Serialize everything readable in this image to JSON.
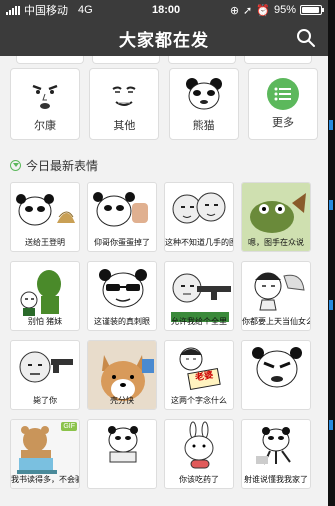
{
  "status_bar": {
    "carrier": "中国移动",
    "network": "4G",
    "time": "18:00",
    "battery": "95%",
    "battery_level": 0.95
  },
  "header": {
    "title": "大家都在发",
    "search_icon": "search-icon"
  },
  "categories": [
    {
      "label": "尔康",
      "icon": "erkang-face"
    },
    {
      "label": "其他",
      "icon": "smug-face"
    },
    {
      "label": "熊猫",
      "icon": "panda-face"
    },
    {
      "label": "更多",
      "icon": "list-icon"
    }
  ],
  "section": {
    "title": "今日最新表情"
  },
  "stickers": [
    {
      "caption": "送给王登明",
      "type": "panda-poop"
    },
    {
      "caption": "仰哥你蛋蛋掉了",
      "type": "panda-hand"
    },
    {
      "caption": "这种不知道几手的图你还在发",
      "type": "two-faces"
    },
    {
      "caption": "嗯，图手在众说",
      "type": "frog-cartoon"
    },
    {
      "caption": "别怕  猪妹",
      "type": "green-monster"
    },
    {
      "caption": "这谨装的真刺眼",
      "type": "panda-sunglasses"
    },
    {
      "caption": "允许我给个全里",
      "type": "face-gun"
    },
    {
      "caption": "你都要上天当仙女么",
      "type": "girl-fan"
    },
    {
      "caption": "毙了你",
      "type": "face-pistol"
    },
    {
      "caption": "壳分快",
      "type": "shiba-dog"
    },
    {
      "caption": "这两个字念什么",
      "type": "girl-sign",
      "sign": "老婆"
    },
    {
      "caption": "",
      "type": "panda-angry"
    },
    {
      "caption": "我书读得多，不会骗人的",
      "type": "bear-reading",
      "badge": "GIF"
    },
    {
      "caption": "",
      "type": "panda-book"
    },
    {
      "caption": "你该吃药了",
      "type": "bunny-pill"
    },
    {
      "caption": "射谁说懂我我家了",
      "type": "panda-running"
    }
  ],
  "colors": {
    "bar": "#3b3b3b",
    "accent": "#5cb85c",
    "background": "#f2f2f2"
  }
}
